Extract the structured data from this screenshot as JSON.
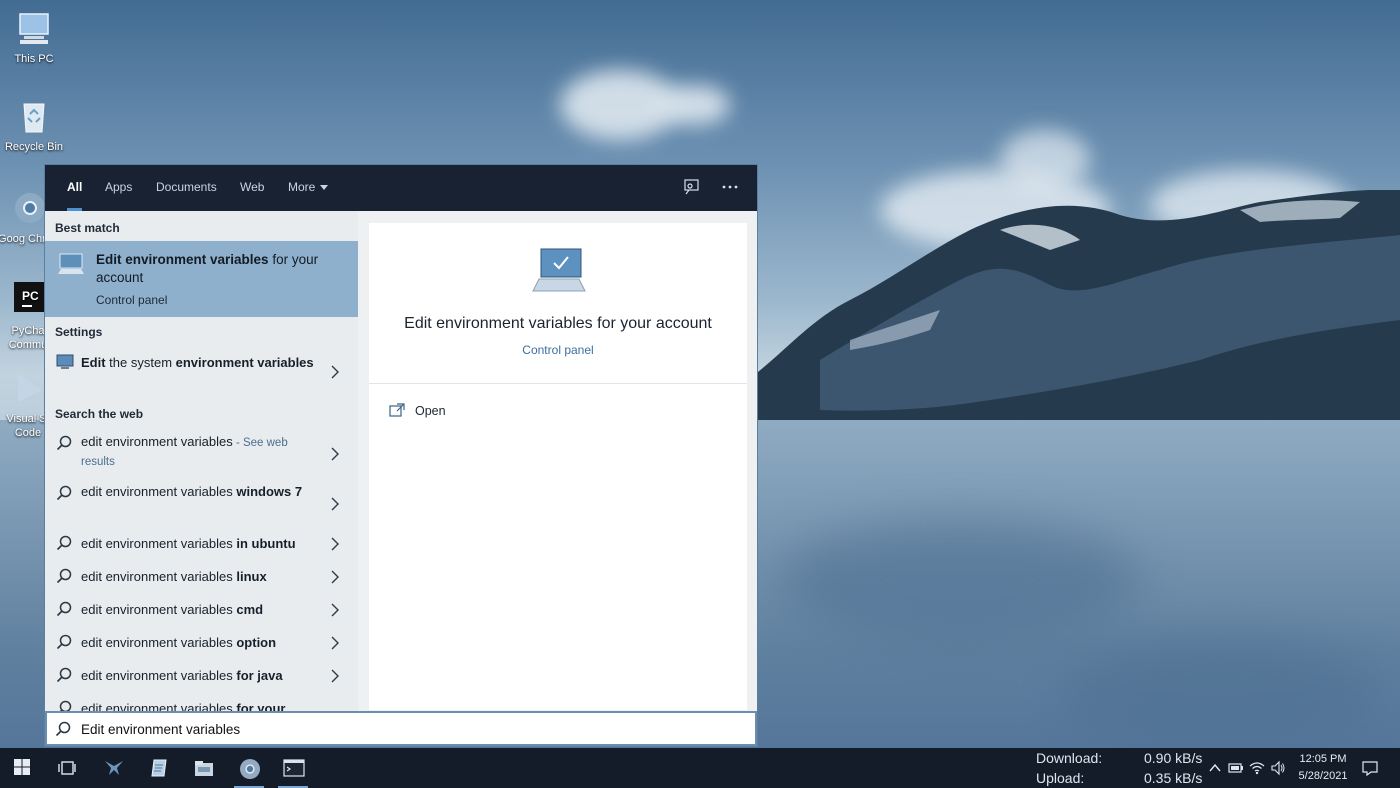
{
  "desktop": {
    "icons": [
      {
        "label": "This PC"
      },
      {
        "label": "Recycle Bin"
      },
      {
        "label": "Goog Chron"
      },
      {
        "label": "PyCha Commu"
      },
      {
        "label": "Visual St Code"
      }
    ]
  },
  "search": {
    "tabs": [
      {
        "label": "All",
        "active": true
      },
      {
        "label": "Apps"
      },
      {
        "label": "Documents"
      },
      {
        "label": "Web"
      },
      {
        "label": "More"
      }
    ],
    "header_icons": [
      "feedback-icon",
      "more-options-icon"
    ],
    "sections": {
      "best_match": "Best match",
      "settings": "Settings",
      "search_web": "Search the web"
    },
    "best_match": {
      "title_bold": "Edit environment variables",
      "title_rest": " for your account",
      "subtitle": "Control panel"
    },
    "settings_item": {
      "part1": "Edit",
      "part2": " the system ",
      "part3": "environment variables"
    },
    "web_results": [
      {
        "base": "edit environment variables",
        "extra": "",
        "see_web": " - See web results"
      },
      {
        "base": "edit environment variables",
        "extra": " windows 7"
      },
      {
        "base": "edit environment variables",
        "extra": " in ubuntu"
      },
      {
        "base": "edit environment variables",
        "extra": " linux"
      },
      {
        "base": "edit environment variables",
        "extra": " cmd"
      },
      {
        "base": "edit environment variables",
        "extra": " option"
      },
      {
        "base": "edit environment variables",
        "extra": " for java"
      },
      {
        "base": "edit environment variables",
        "extra": " for your"
      }
    ],
    "preview": {
      "title": "Edit environment variables for your account",
      "subtitle": "Control panel",
      "action_open": "Open"
    },
    "query": "Edit environment variables"
  },
  "taskbar": {
    "network": {
      "download_label": "Download:",
      "download_value": "0.90 kB/s",
      "upload_label": "Upload:",
      "upload_value": "0.35 kB/s"
    },
    "clock": {
      "time": "12:05 PM",
      "date": "5/28/2021"
    }
  },
  "colors": {
    "search_header": "#182233",
    "best_match_highlight": "#8fb0cc",
    "taskbar": "#131c28",
    "accent": "#4d8fd6"
  }
}
